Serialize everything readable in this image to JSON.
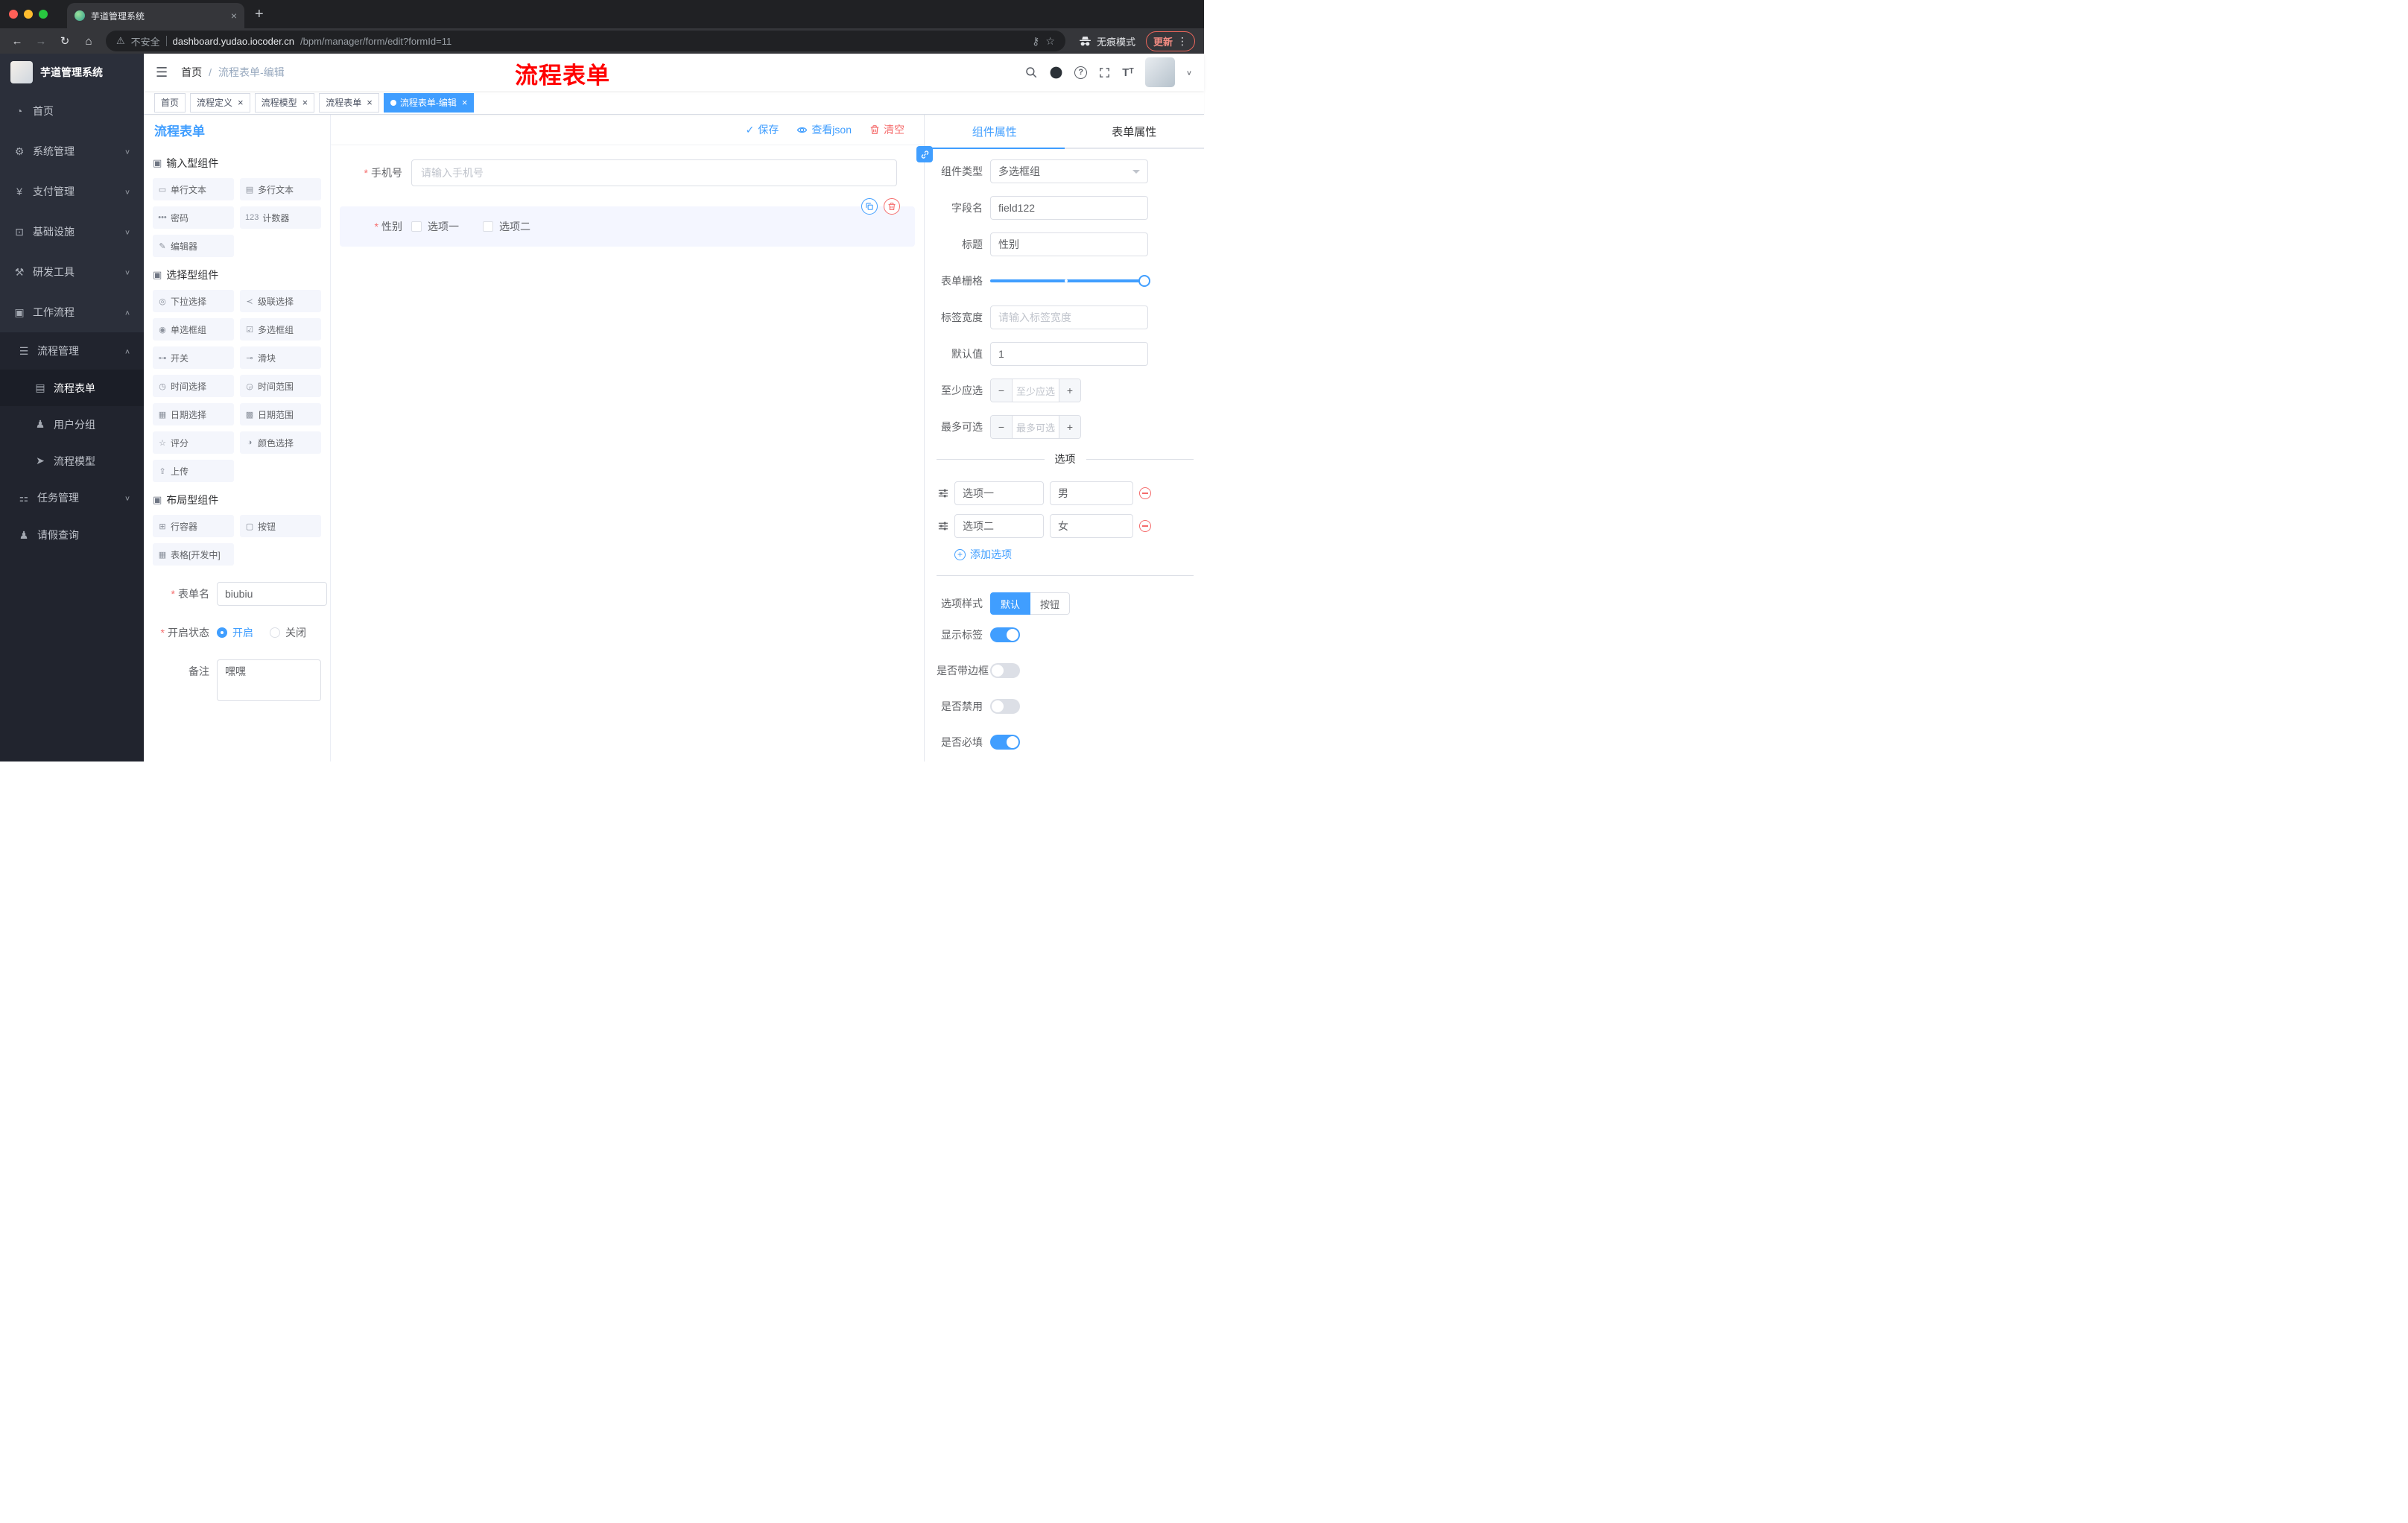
{
  "browser": {
    "tab_title": "芋道管理系统",
    "security_label": "不安全",
    "url_host": "dashboard.yudao.iocoder.cn",
    "url_path": "/bpm/manager/form/edit?formId=11",
    "incognito_label": "无痕模式",
    "update_label": "更新"
  },
  "sidebar": {
    "logo_title": "芋道管理系统",
    "items": [
      {
        "label": "首页"
      },
      {
        "label": "系统管理"
      },
      {
        "label": "支付管理"
      },
      {
        "label": "基础设施"
      },
      {
        "label": "研发工具"
      },
      {
        "label": "工作流程"
      },
      {
        "label": "流程管理"
      },
      {
        "label": "流程表单"
      },
      {
        "label": "用户分组"
      },
      {
        "label": "流程模型"
      },
      {
        "label": "任务管理"
      },
      {
        "label": "请假查询"
      }
    ]
  },
  "navbar": {
    "breadcrumb_home": "首页",
    "breadcrumb_current": "流程表单-编辑",
    "annotation": "流程表单"
  },
  "tags": [
    {
      "label": "首页"
    },
    {
      "label": "流程定义"
    },
    {
      "label": "流程模型"
    },
    {
      "label": "流程表单"
    },
    {
      "label": "流程表单-编辑"
    }
  ],
  "designer": {
    "title": "流程表单",
    "save_label": "保存",
    "view_json_label": "查看json",
    "clear_label": "清空",
    "sections": {
      "input": {
        "title": "输入型组件",
        "items": [
          "单行文本",
          "多行文本",
          "密码",
          "计数器",
          "编辑器"
        ]
      },
      "select": {
        "title": "选择型组件",
        "items": [
          "下拉选择",
          "级联选择",
          "单选框组",
          "多选框组",
          "开关",
          "滑块",
          "时间选择",
          "时间范围",
          "日期选择",
          "日期范围",
          "评分",
          "颜色选择",
          "上传"
        ]
      },
      "layout": {
        "title": "布局型组件",
        "items": [
          "行容器",
          "按钮",
          "表格[开发中]"
        ]
      }
    },
    "meta": {
      "name_label": "表单名",
      "name_value": "biubiu",
      "status_label": "开启状态",
      "status_on": "开启",
      "status_off": "关闭",
      "remark_label": "备注",
      "remark_value": "嘿嘿"
    },
    "canvas": {
      "phone_label": "手机号",
      "phone_placeholder": "请输入手机号",
      "gender_label": "性别",
      "gender_option1": "选项一",
      "gender_option2": "选项二"
    }
  },
  "props": {
    "tab_component": "组件属性",
    "tab_form": "表单属性",
    "component_type_label": "组件类型",
    "component_type_value": "多选框组",
    "field_name_label": "字段名",
    "field_name_value": "field122",
    "title_label": "标题",
    "title_value": "性别",
    "grid_label": "表单栅格",
    "label_width_label": "标签宽度",
    "label_width_placeholder": "请输入标签宽度",
    "default_label": "默认值",
    "default_value": "1",
    "min_label": "至少应选",
    "min_placeholder": "至少应选",
    "max_label": "最多可选",
    "max_placeholder": "最多可选",
    "options_title": "选项",
    "options": [
      {
        "label": "选项一",
        "value": "男"
      },
      {
        "label": "选项二",
        "value": "女"
      }
    ],
    "add_option_label": "添加选项",
    "option_style_label": "选项样式",
    "option_style_default": "默认",
    "option_style_button": "按钮",
    "switch_show_label": "显示标签",
    "switch_border": "是否带边框",
    "switch_disabled": "是否禁用",
    "switch_required": "是否必填"
  },
  "colors": {
    "primary": "#409eff",
    "danger": "#f56c6c",
    "annotation_red": "#ff0000",
    "sidebar_bg": "#2b2f3a"
  }
}
